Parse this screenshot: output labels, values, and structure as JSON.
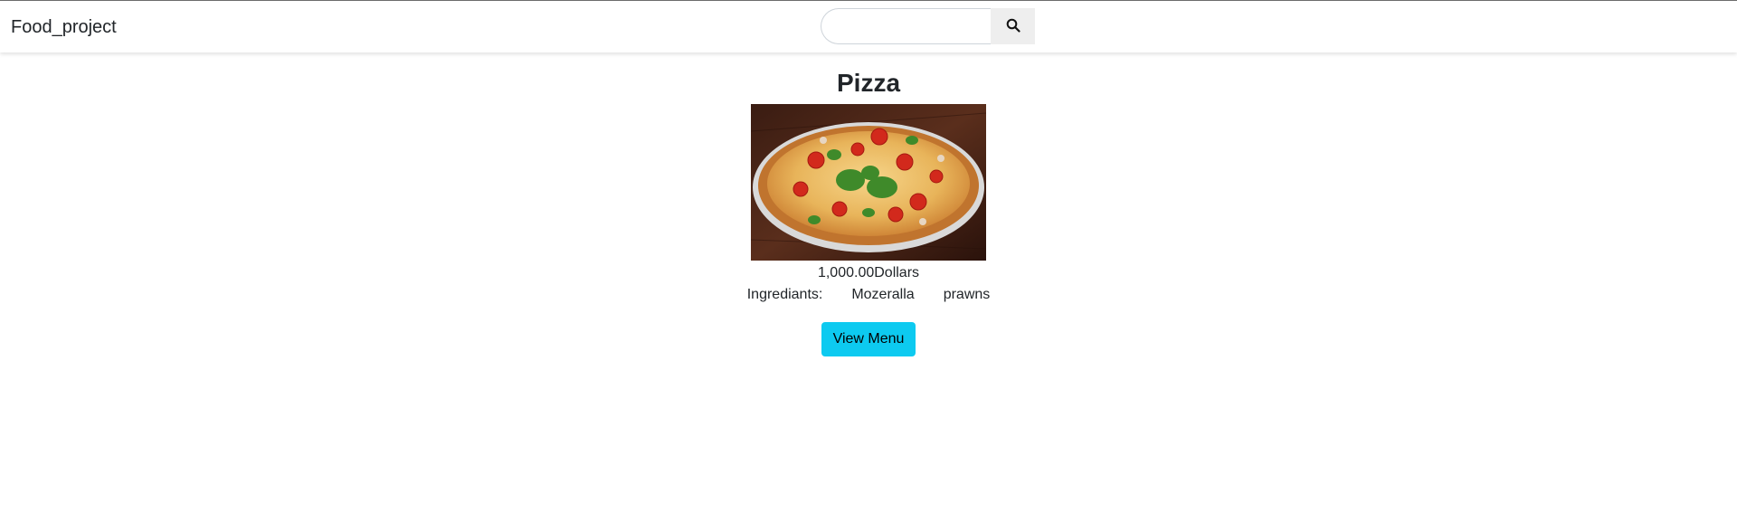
{
  "navbar": {
    "brand": "Food_project",
    "search": {
      "value": "",
      "placeholder": "",
      "button_icon": "search-icon"
    }
  },
  "product": {
    "title": "Pizza",
    "image_alt": "Pizza",
    "price_amount": "1,000.00",
    "price_unit": "Dollars",
    "ingredients_label": "Ingrediants:",
    "ingredients": [
      "Mozeralla",
      "prawns"
    ],
    "button_label": "View Menu"
  },
  "colors": {
    "button_bg": "#0dcaf0",
    "search_button_bg": "#eeeeee",
    "text": "#212529"
  }
}
